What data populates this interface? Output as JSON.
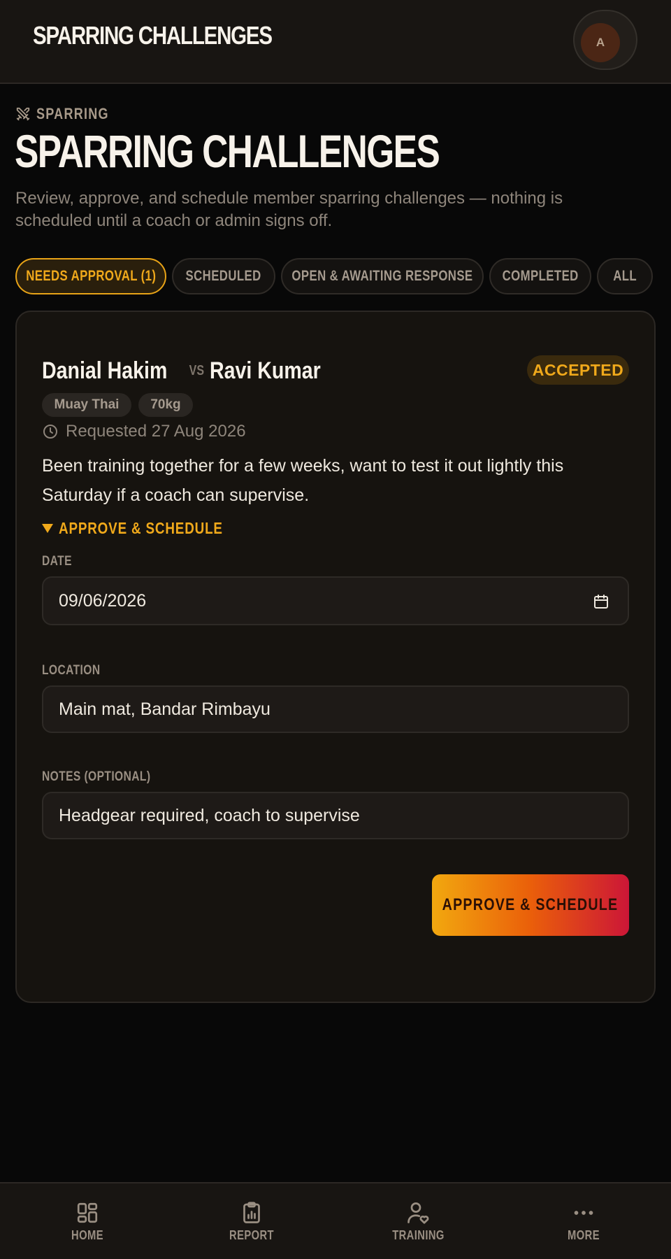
{
  "topbar": {
    "title": "SPARRING CHALLENGES",
    "avatar_initial": "A"
  },
  "header": {
    "eyebrow": "SPARRING",
    "eyebrow_icon": "crossed-swords-icon",
    "title": "SPARRING CHALLENGES",
    "subtitle": "Review, approve, and schedule member sparring challenges — nothing is scheduled until a coach or admin signs off."
  },
  "filters": [
    {
      "label": "NEEDS APPROVAL (1)",
      "active": true
    },
    {
      "label": "SCHEDULED",
      "active": false
    },
    {
      "label": "OPEN & AWAITING RESPONSE",
      "active": false
    },
    {
      "label": "COMPLETED",
      "active": false
    },
    {
      "label": "ALL",
      "active": false
    }
  ],
  "challenge": {
    "fighter_a": "Danial Hakim",
    "vs": "VS",
    "fighter_b": "Ravi Kumar",
    "status": "ACCEPTED",
    "tags": [
      "Muay Thai",
      "70kg"
    ],
    "requested": "Requested 27 Aug 2026",
    "message": "Been training together for a few weeks, want to test it out lightly this Saturday if a coach can supervise.",
    "disclosure_label": "APPROVE & SCHEDULE",
    "form": {
      "date_label": "DATE",
      "date_value": "09/06/2026",
      "location_label": "LOCATION",
      "location_value": "Main mat, Bandar Rimbayu",
      "notes_label": "NOTES (OPTIONAL)",
      "notes_value": "Headgear required, coach to supervise",
      "submit_label": "APPROVE & SCHEDULE"
    }
  },
  "nav": [
    {
      "label": "HOME",
      "icon": "dashboard-icon"
    },
    {
      "label": "REPORT",
      "icon": "clipboard-chart-icon"
    },
    {
      "label": "TRAINING",
      "icon": "user-heart-icon"
    },
    {
      "label": "MORE",
      "icon": "more-dots-icon"
    }
  ],
  "colors": {
    "accent": "#f0a91b",
    "background": "#080808",
    "surface": "#16130f",
    "gradient_start": "#f2a80f",
    "gradient_end": "#cc1637"
  }
}
